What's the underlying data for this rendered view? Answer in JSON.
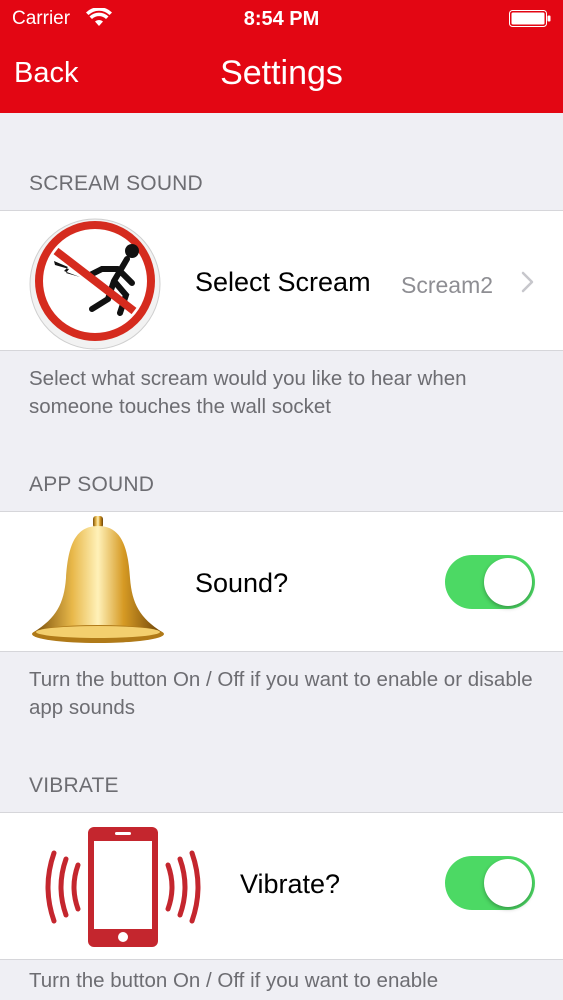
{
  "status_bar": {
    "carrier": "Carrier",
    "time": "8:54 PM"
  },
  "nav": {
    "back_label": "Back",
    "title": "Settings"
  },
  "sections": [
    {
      "header": "SCREAM SOUND",
      "label": "Select Scream",
      "detail": "Scream2",
      "footer": "Select what scream would you like to hear when someone touches the wall socket",
      "icon": "no-electric-shock-icon"
    },
    {
      "header": "APP SOUND",
      "label": "Sound?",
      "switch_on": true,
      "footer": "Turn the button On / Off if you want to enable or disable app sounds",
      "icon": "bell-icon"
    },
    {
      "header": "VIBRATE",
      "label": "Vibrate?",
      "switch_on": true,
      "footer": "Turn the button On / Off if you want to enable",
      "icon": "vibrating-phone-icon"
    }
  ],
  "colors": {
    "nav_bar": "#e30613",
    "switch_on": "#4cd964",
    "background": "#efeff4"
  }
}
